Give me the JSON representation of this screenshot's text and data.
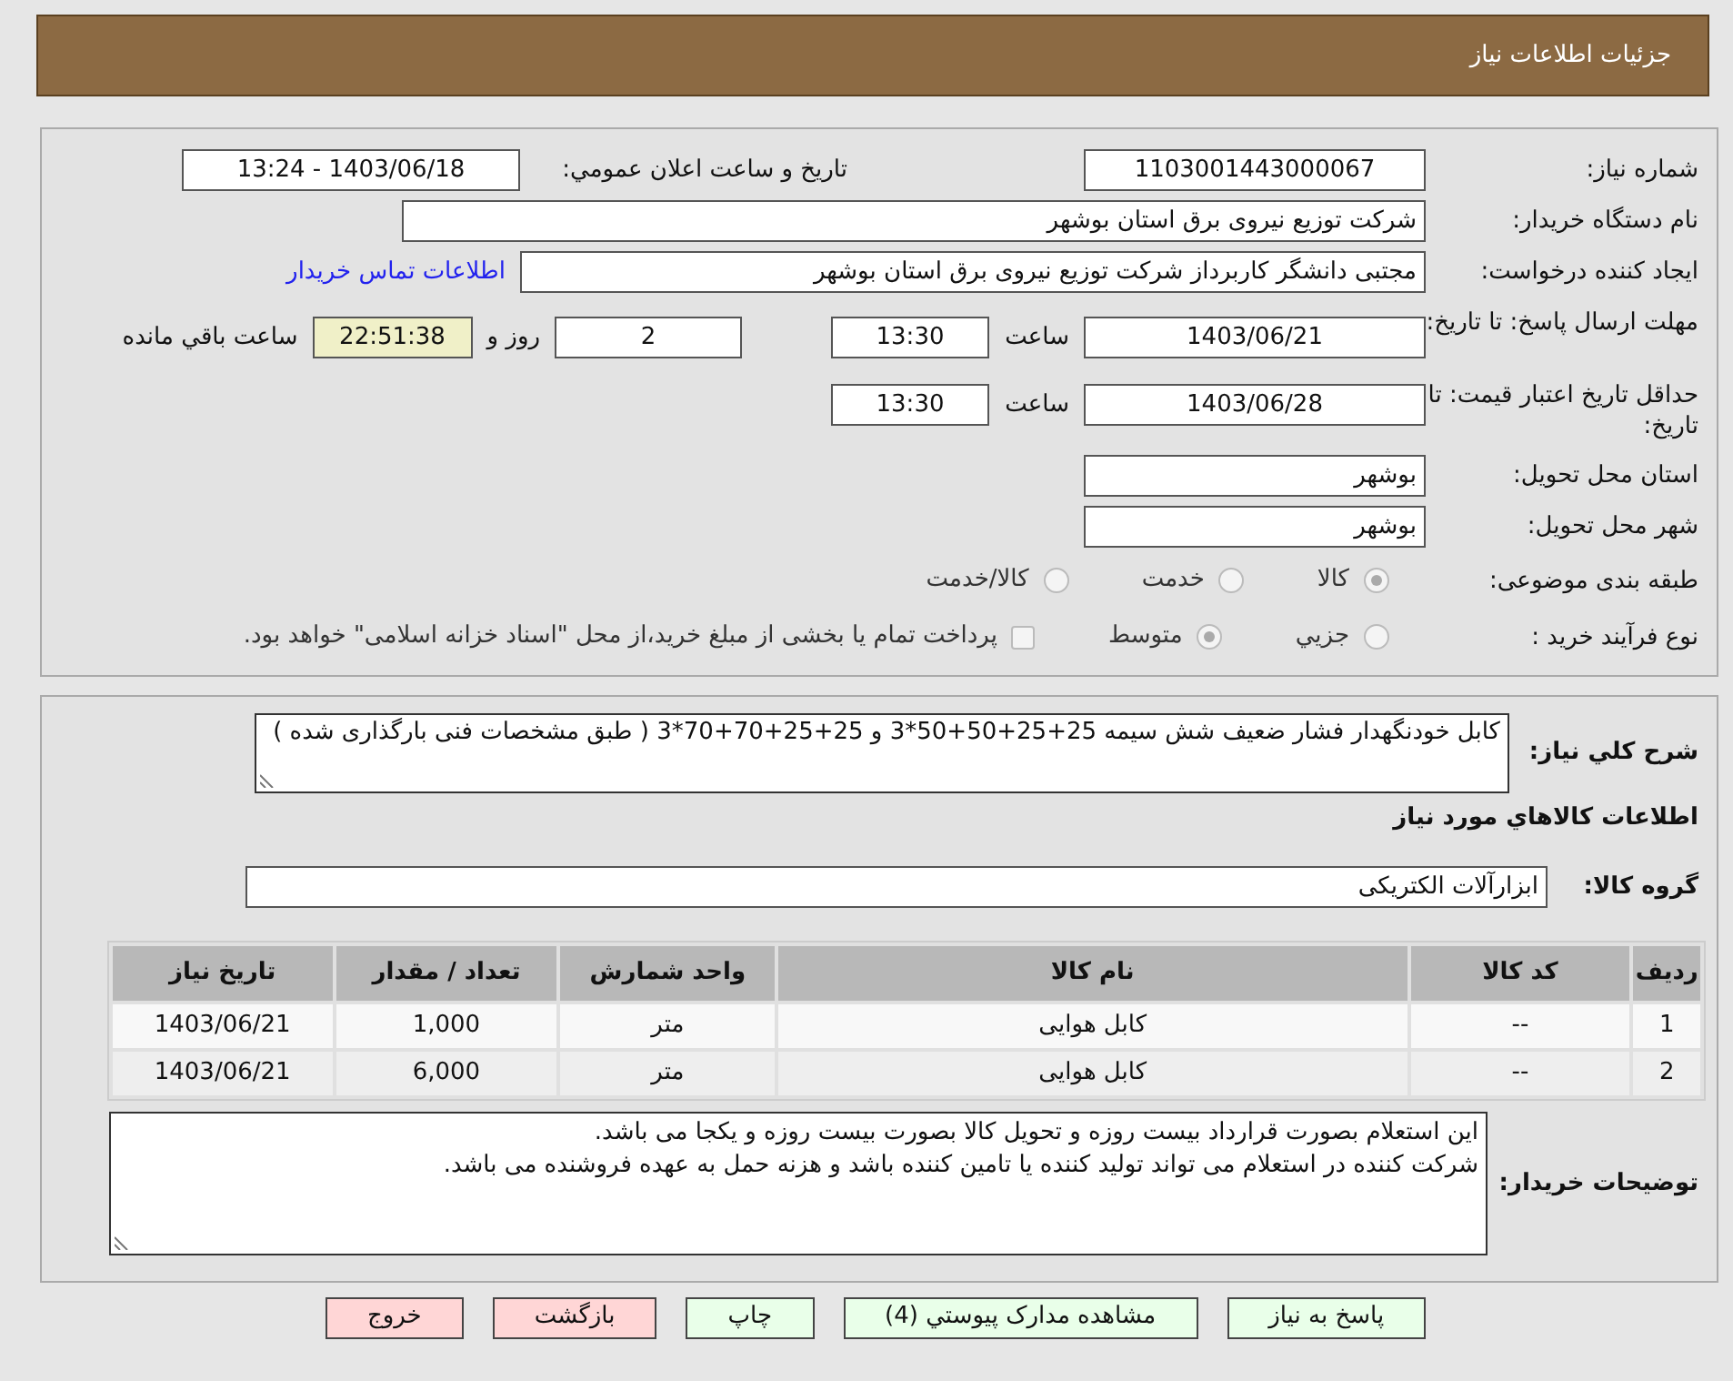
{
  "header": {
    "title": "جزئیات اطلاعات نیاز"
  },
  "need_number": {
    "label": "شماره نیاز:",
    "value": "1103001443000067"
  },
  "announce": {
    "label": "تاریخ و ساعت اعلان عمومي:",
    "value": "1403/06/18 - 13:24"
  },
  "buyer": {
    "label": "نام دستگاه خریدار:",
    "value": "شرکت توزیع نیروی برق استان بوشهر"
  },
  "requester": {
    "label": "ایجاد کننده درخواست:",
    "value": "مجتبی دانشگر کاربرداز شرکت توزیع نیروی برق استان بوشهر",
    "link": "اطلاعات تماس خریدار"
  },
  "deadline": {
    "label": "مهلت ارسال پاسخ: تا تاریخ:",
    "date": "1403/06/21",
    "time_label": "ساعت",
    "time": "13:30",
    "days": "2",
    "days_label": "روز و",
    "remaining": "22:51:38",
    "remaining_label": "ساعت باقي مانده"
  },
  "validity": {
    "label": "حداقل تاریخ اعتبار قیمت: تا تاریخ:",
    "date": "1403/06/28",
    "time_label": "ساعت",
    "time": "13:30"
  },
  "province": {
    "label": "استان محل تحویل:",
    "value": "بوشهر"
  },
  "city": {
    "label": "شهر محل تحویل:",
    "value": "بوشهر"
  },
  "category": {
    "label": "طبقه بندی موضوعی:",
    "options": [
      {
        "label": "کالا",
        "selected": true
      },
      {
        "label": "خدمت",
        "selected": false
      },
      {
        "label": "کالا/خدمت",
        "selected": false
      }
    ]
  },
  "process": {
    "label": "نوع فرآیند خرید :",
    "options": [
      {
        "label": "جزيي",
        "selected": false
      },
      {
        "label": "متوسط",
        "selected": true
      }
    ],
    "payment": {
      "label": "پرداخت تمام یا بخشی از مبلغ خرید،از محل \"اسناد خزانه اسلامی\" خواهد بود.",
      "checked": false
    }
  },
  "description": {
    "label": "شرح کلي نیاز:",
    "value": "کابل خودنگهدار فشار ضعیف شش سیمه 25+25+50+50*3 و 25+25+70+70*3 ( طبق مشخصات فنی بارگذاری شده )"
  },
  "goods_heading": "اطلاعات کالاهاي مورد نیاز",
  "goods_group": {
    "label": "گروه کالا:",
    "value": "ابزارآلات الکتریکی"
  },
  "table": {
    "columns": [
      "ردیف",
      "کد کالا",
      "نام کالا",
      "واحد شمارش",
      "تعداد / مقدار",
      "تاریخ نیاز"
    ],
    "rows": [
      [
        "1",
        "--",
        "کابل هوایی",
        "متر",
        "1,000",
        "1403/06/21"
      ],
      [
        "2",
        "--",
        "کابل هوایی",
        "متر",
        "6,000",
        "1403/06/21"
      ]
    ]
  },
  "notes": {
    "label": "توضیحات خریدار:",
    "lines": [
      "این استعلام بصورت قرارداد بیست روزه و تحویل کالا بصورت بیست روزه و یکجا می باشد.",
      "شرکت کننده در استعلام می تواند تولید کننده یا تامین کننده باشد و هزنه حمل به عهده فروشنده می باشد."
    ]
  },
  "buttons": [
    {
      "label": "پاسخ به نیاز",
      "kind": "primary"
    },
    {
      "label": "مشاهده مدارک پیوستي (4)",
      "kind": "primary"
    },
    {
      "label": "چاپ",
      "kind": "primary"
    },
    {
      "label": "بازگشت",
      "kind": "danger"
    },
    {
      "label": "خروج",
      "kind": "danger"
    }
  ]
}
